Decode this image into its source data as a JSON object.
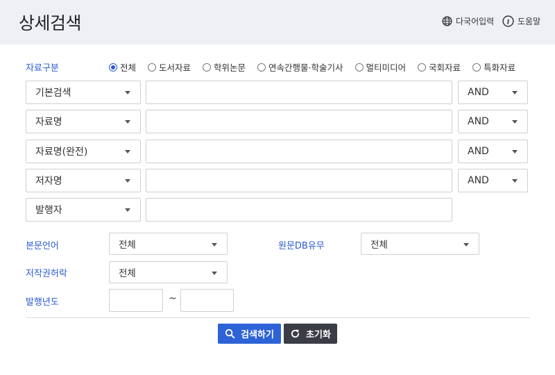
{
  "header": {
    "title": "상세검색",
    "multilang_label": "다국어입력",
    "help_label": "도움말"
  },
  "material_type": {
    "label": "자료구분",
    "options": [
      "전체",
      "도서자료",
      "학위논문",
      "연속간행물·학술기사",
      "멀티미디어",
      "국회자료",
      "특화자료"
    ],
    "selected": "전체"
  },
  "search_rows": [
    {
      "field": "기본검색",
      "value": "",
      "operator": "AND"
    },
    {
      "field": "자료명",
      "value": "",
      "operator": "AND"
    },
    {
      "field": "자료명(완전)",
      "value": "",
      "operator": "AND"
    },
    {
      "field": "저자명",
      "value": "",
      "operator": "AND"
    },
    {
      "field": "발행자",
      "value": ""
    }
  ],
  "filters": {
    "body_language": {
      "label": "본문언어",
      "value": "전체"
    },
    "original_db": {
      "label": "원문DB유무",
      "value": "전체"
    },
    "copyright": {
      "label": "저작권허락",
      "value": "전체"
    },
    "pub_year": {
      "label": "발행년도",
      "from": "",
      "to": "",
      "separator": "~"
    }
  },
  "buttons": {
    "search": "검색하기",
    "reset": "초기화"
  },
  "colors": {
    "accent": "#2a5bd1",
    "header_bg": "#eef0f6",
    "search_button": "#2d63d6",
    "reset_button": "#3a3d45"
  },
  "icons": {
    "multilang": "globe-icon",
    "help": "info-icon",
    "search": "search-icon",
    "reset": "refresh-icon",
    "dropdown": "caret-down-icon"
  }
}
